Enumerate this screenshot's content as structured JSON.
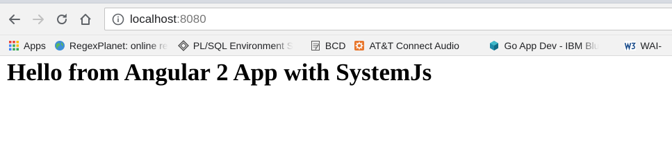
{
  "browser": {
    "address_bar": {
      "host": "localhost",
      "port": ":8080"
    },
    "nav_icons": [
      "back-arrow-icon",
      "forward-arrow-icon",
      "reload-icon",
      "home-icon"
    ]
  },
  "bookmarks": [
    {
      "label": "Apps",
      "icon": "apps-grid-icon"
    },
    {
      "label": "RegexPlanet: online re",
      "icon": "globe-icon"
    },
    {
      "label": "PL/SQL Environment S",
      "icon": "diamond-icon"
    },
    {
      "label": "BCD",
      "icon": "notepad-icon"
    },
    {
      "label": "AT&T Connect Audio",
      "icon": "orange-gear-icon"
    },
    {
      "label": "Go App Dev - IBM Blu",
      "icon": "ibm-bluemix-icon"
    },
    {
      "label": "WAI-",
      "icon": "w3c-icon"
    }
  ],
  "page": {
    "heading": "Hello from Angular 2 App with SystemJs"
  },
  "colors": {
    "toolbar_bg": "#f2f2f2",
    "text": "#202124",
    "port_text": "#777777",
    "heading": "#000000"
  }
}
